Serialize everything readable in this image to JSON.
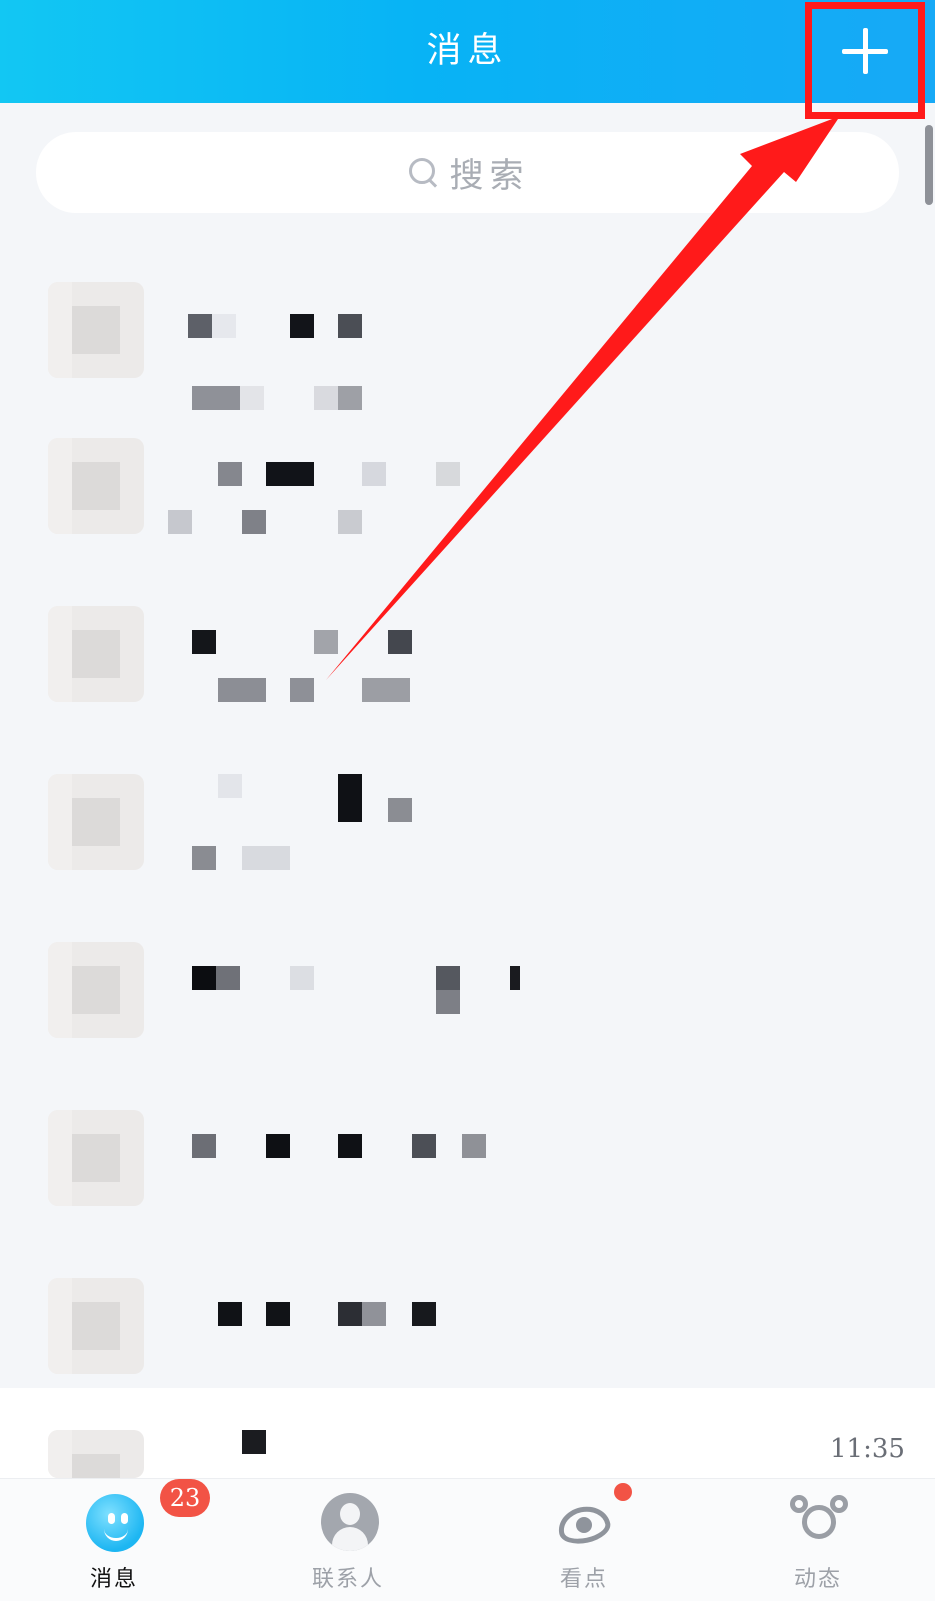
{
  "header": {
    "title": "消息",
    "plus_icon": "plus-icon"
  },
  "search": {
    "placeholder": "搜索",
    "icon": "search-icon"
  },
  "conversation_list": {
    "last_item_time": "11:35"
  },
  "tabbar": {
    "tabs": [
      {
        "label": "消息",
        "icon": "message-face-icon",
        "badge": "23",
        "active": true
      },
      {
        "label": "联系人",
        "icon": "contacts-icon",
        "active": false
      },
      {
        "label": "看点",
        "icon": "watch-eye-icon",
        "dot": true,
        "active": false
      },
      {
        "label": "动态",
        "icon": "dynamics-icon",
        "active": false
      }
    ]
  },
  "annotation": {
    "highlight_color": "#ff1a1a"
  },
  "colors": {
    "header_gradient_start": "#12c7f3",
    "header_gradient_end": "#17a9f6",
    "badge_red": "#f25345",
    "background": "#f4f6f9"
  }
}
